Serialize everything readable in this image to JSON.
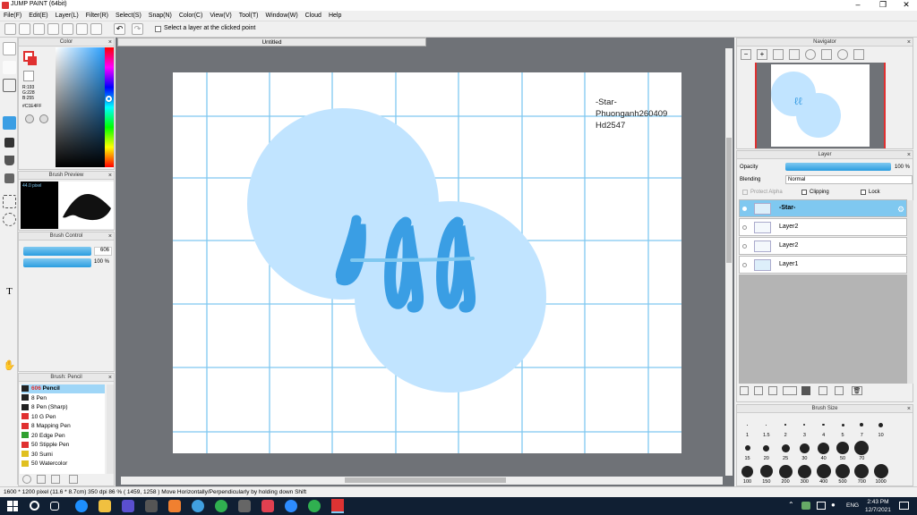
{
  "app": {
    "title": "JUMP PAINT (64bit)"
  },
  "menu": [
    "File(F)",
    "Edit(E)",
    "Layer(L)",
    "Filter(R)",
    "Select(S)",
    "Snap(N)",
    "Color(C)",
    "View(V)",
    "Tool(T)",
    "Window(W)",
    "Cloud",
    "Help"
  ],
  "toolbar": {
    "select_layer_label": "Select a layer at the clicked point"
  },
  "color_panel": {
    "title": "Color",
    "r": "R:193",
    "g": "G:228",
    "b": "B:255",
    "hex": "#C1E4FF"
  },
  "brush_preview": {
    "title": "Brush Preview",
    "size": "44.0 pixel"
  },
  "brush_control": {
    "title": "Brush Control",
    "size_value": "606",
    "opacity_value": "100 %"
  },
  "brush_list": {
    "title": "Brush: Pencil",
    "items": [
      {
        "size": "606",
        "name": "Pencil",
        "color": "#222222"
      },
      {
        "size": "8",
        "name": "Pen",
        "color": "#222222"
      },
      {
        "size": "8",
        "name": "Pen (Sharp)",
        "color": "#222222"
      },
      {
        "size": "10",
        "name": "G Pen",
        "color": "#e03030"
      },
      {
        "size": "8",
        "name": "Mapping Pen",
        "color": "#e03030"
      },
      {
        "size": "20",
        "name": "Edge Pen",
        "color": "#30a030"
      },
      {
        "size": "50",
        "name": "Stipple Pen",
        "color": "#e03030"
      },
      {
        "size": "30",
        "name": "Sumi",
        "color": "#e0c020"
      },
      {
        "size": "50",
        "name": "Watercolor",
        "color": "#e0c020"
      }
    ]
  },
  "document": {
    "tab": "Untitled",
    "text_lines": [
      "-Star-",
      "Phuonganh260409",
      "Hd2547"
    ],
    "circle_color": "#c1e4ff",
    "grid_color": "#7fc8f0"
  },
  "navigator": {
    "title": "Navigator"
  },
  "layer_panel": {
    "title": "Layer",
    "opacity_label": "Opacity",
    "opacity_value": "100 %",
    "blending_label": "Blending",
    "blending_value": "Normal",
    "protect_alpha": "Protect Alpha",
    "clipping": "Clipping",
    "lock": "Lock",
    "layers": [
      "-Star-",
      "Layer2",
      "Layer2",
      "Layer1"
    ]
  },
  "brush_size": {
    "title": "Brush Size",
    "rows": [
      [
        "1",
        "1.5",
        "2",
        "3",
        "4",
        "5",
        "7",
        "10"
      ],
      [
        "15",
        "20",
        "25",
        "30",
        "40",
        "50",
        "70"
      ],
      [
        "100",
        "150",
        "200",
        "300",
        "400",
        "500",
        "700",
        "1000"
      ]
    ]
  },
  "status": {
    "text": "1600 * 1200 pixel  (11.6 * 8.7cm)  350 dpi  86 %  ( 1459, 1258 )  Move Horizontally/Perpendicularly by holding down Shift"
  },
  "taskbar": {
    "lang": "ENG",
    "time": "2:43 PM",
    "date": "12/7/2021"
  }
}
